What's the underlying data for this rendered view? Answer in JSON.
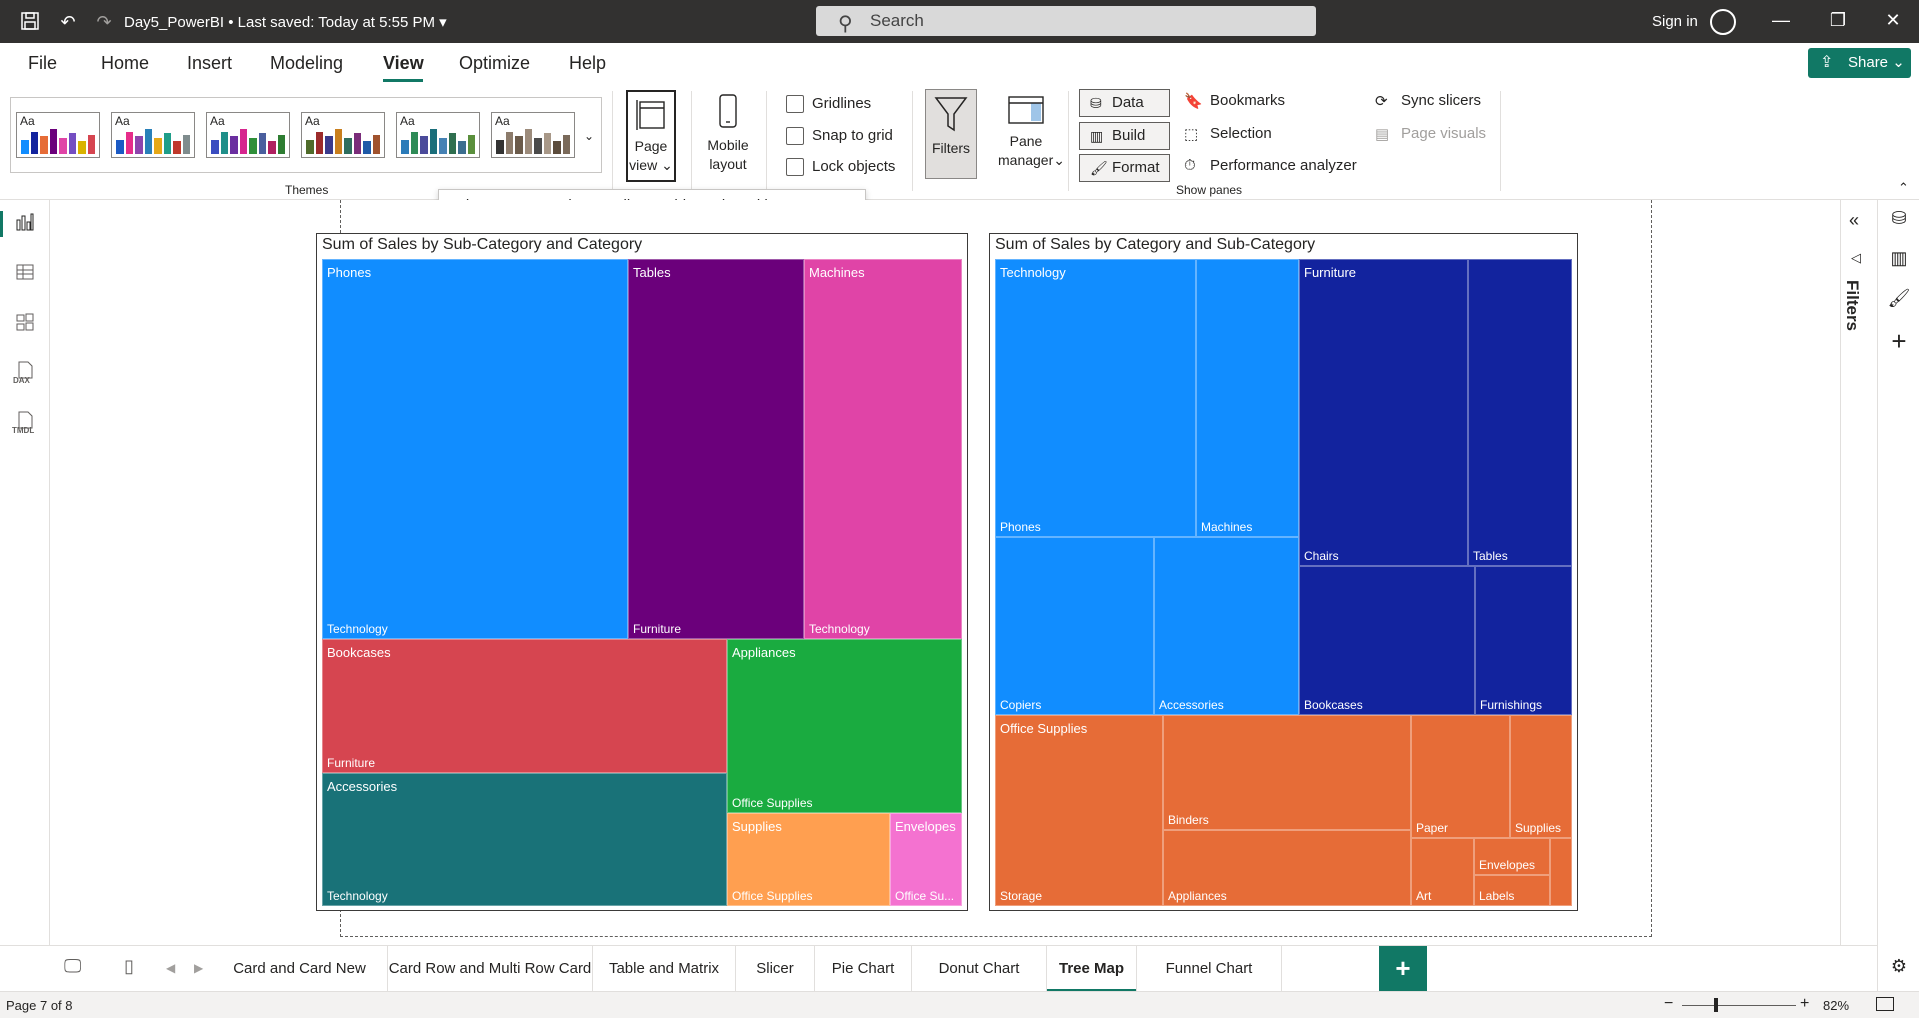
{
  "titlebar": {
    "file_name": "Day5_PowerBI",
    "saved_status": "Last saved: Today at 5:55 PM",
    "search_placeholder": "Search",
    "sign_in": "Sign in"
  },
  "menu": {
    "items": [
      "File",
      "Home",
      "Insert",
      "Modeling",
      "View",
      "Optimize",
      "Help"
    ],
    "active": "View",
    "share": "Share"
  },
  "ribbon": {
    "themes_label": "Themes",
    "theme_aa": "Aa",
    "page_view": [
      "Page",
      "view"
    ],
    "mobile_layout": [
      "Mobile",
      "layout"
    ],
    "page_options": {
      "gridlines": "Gridlines",
      "snap_to_grid": "Snap to grid",
      "lock_objects": "Lock objects"
    },
    "filters": "Filters",
    "pane_manager": [
      "Pane",
      "manager"
    ],
    "data": "Data",
    "build": "Build",
    "format": "Format",
    "bookmarks": "Bookmarks",
    "selection": "Selection",
    "performance_analyzer": "Performance analyzer",
    "sync_slicers": "Sync slicers",
    "page_visuals": "Page visuals",
    "show_panes": "Show panes",
    "tooltip": "Choose a page view. We'll save this setting with your report."
  },
  "theme_palettes": [
    [
      "#118dff",
      "#12239e",
      "#e66c37",
      "#6b007b",
      "#e044a7",
      "#744ec2",
      "#d9b300",
      "#d64550"
    ],
    [
      "#1b5ac4",
      "#e62d8a",
      "#8e44ad",
      "#2980b9",
      "#e6a817",
      "#1f9e89",
      "#c0392b",
      "#7f8c8d"
    ],
    [
      "#3a4cc0",
      "#1f8f89",
      "#6b2fa0",
      "#d6268e",
      "#2f8f3a",
      "#4a5f9e",
      "#b02060",
      "#2e7d32"
    ],
    [
      "#4f6b2a",
      "#9c2b2b",
      "#3a3a8c",
      "#c97f1e",
      "#2e6e5e",
      "#7a2d7a",
      "#1e5aa8",
      "#a0522d"
    ],
    [
      "#2b7bb9",
      "#2e8b57",
      "#4b4b9b",
      "#1a6e7a",
      "#4682b4",
      "#2f6f4f",
      "#3c6e8f",
      "#5a8f3c"
    ],
    [
      "#333333",
      "#8c7b6b",
      "#6b5b4b",
      "#9c8b7b",
      "#4b4b4b",
      "#a89888",
      "#5c4c3c",
      "#7a6a5a"
    ]
  ],
  "visuals": {
    "left": {
      "title": "Sum of Sales by Sub-Category and Category",
      "tiles": [
        {
          "top": "Phones",
          "bottom": "Technology",
          "color": "#118dff"
        },
        {
          "top": "Tables",
          "bottom": "Furniture",
          "color": "#6b007b"
        },
        {
          "top": "Machines",
          "bottom": "Technology",
          "color": "#e044a7"
        },
        {
          "top": "Bookcases",
          "bottom": "Furniture",
          "color": "#d64550"
        },
        {
          "top": "Appliances",
          "bottom": "Office Supplies",
          "color": "#1aab40"
        },
        {
          "top": "Accessories",
          "bottom": "Technology",
          "color": "#197278"
        },
        {
          "top": "Supplies",
          "bottom": "Office Supplies",
          "color": "#ff9f50"
        },
        {
          "top": "Envelopes",
          "bottom": "Office Su...",
          "color": "#f472d0"
        }
      ]
    },
    "right": {
      "title": "Sum of Sales by Category and Sub-Category",
      "tiles": [
        {
          "top": "Technology",
          "bottom": "Phones",
          "color": "#118dff"
        },
        {
          "top": "",
          "bottom": "Machines",
          "color": "#118dff"
        },
        {
          "top": "",
          "bottom": "Copiers",
          "color": "#118dff"
        },
        {
          "top": "",
          "bottom": "Accessories",
          "color": "#118dff"
        },
        {
          "top": "Furniture",
          "bottom": "Chairs",
          "color": "#12239e"
        },
        {
          "top": "",
          "bottom": "Tables",
          "color": "#12239e"
        },
        {
          "top": "",
          "bottom": "Bookcases",
          "color": "#12239e"
        },
        {
          "top": "",
          "bottom": "Furnishings",
          "color": "#12239e"
        },
        {
          "top": "Office Supplies",
          "bottom": "Storage",
          "color": "#e66c37"
        },
        {
          "top": "",
          "bottom": "Binders",
          "color": "#e66c37"
        },
        {
          "top": "",
          "bottom": "Appliances",
          "color": "#e66c37"
        },
        {
          "top": "",
          "bottom": "Paper",
          "color": "#e66c37"
        },
        {
          "top": "",
          "bottom": "Supplies",
          "color": "#e66c37"
        },
        {
          "top": "",
          "bottom": "Art",
          "color": "#e66c37"
        },
        {
          "top": "",
          "bottom": "Envelopes",
          "color": "#e66c37"
        },
        {
          "top": "",
          "bottom": "Labels",
          "color": "#e66c37"
        },
        {
          "top": "",
          "bottom": "",
          "color": "#e66c37"
        }
      ]
    }
  },
  "filters_pane": "Filters",
  "tabs": [
    "Card and Card New",
    "Card Row and Multi Row Card",
    "Table and Matrix",
    "Slicer",
    "Pie Chart",
    "Donut Chart",
    "Tree Map",
    "Funnel Chart"
  ],
  "active_tab": "Tree Map",
  "add_tab": "+",
  "status": {
    "page": "Page 7 of 8",
    "zoom": "82%",
    "zoom_minus": "−",
    "zoom_plus": "+"
  },
  "colors": {
    "accent": "#117865",
    "titlebar": "#323130"
  }
}
